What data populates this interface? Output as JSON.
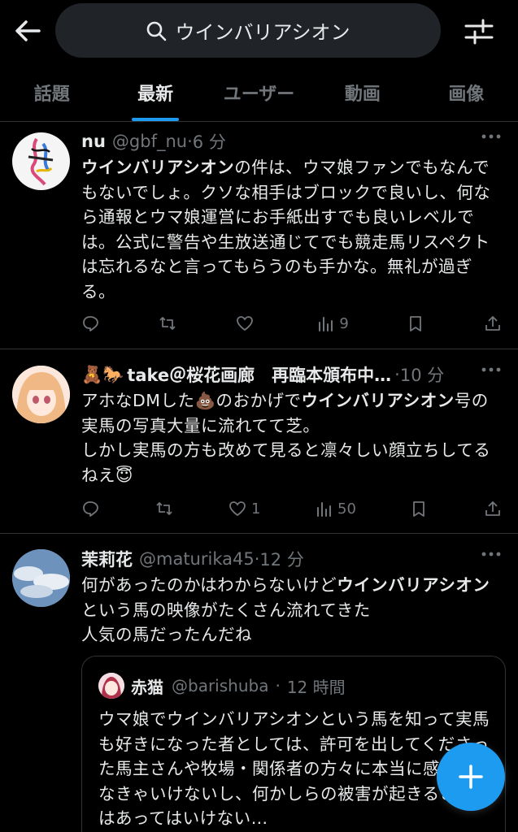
{
  "colors": {
    "accent": "#1d9bf0",
    "background": "#000000",
    "muted": "#71767b",
    "text": "#e7e9ea"
  },
  "search": {
    "query": "ウインバリアシオン"
  },
  "tabs": [
    {
      "label": "話題",
      "active": false
    },
    {
      "label": "最新",
      "active": true
    },
    {
      "label": "ユーザー",
      "active": false
    },
    {
      "label": "動画",
      "active": false
    },
    {
      "label": "画像",
      "active": false
    }
  ],
  "tweets": [
    {
      "name": "nu",
      "handle": "@gbf_nu",
      "sep": "·",
      "time": "6 分",
      "text_bold": "ウインバリアシオン",
      "text_rest": "の件は、ウマ娘ファンでもなんでもないでしょ。クソな相手はブロックで良いし、何なら通報とウマ娘運営にお手紙出すでも良いレベルでは。公式に警告や生放送通じてでも競走馬リスペクトは忘れるなと言ってもらうのも手かな。無礼が過ぎる。",
      "likes": "",
      "views": "9"
    },
    {
      "name_emoji": "🧸🐎",
      "name": "take＠桜花画廊　再臨本頒布中…",
      "sep": "·",
      "time": "10 分",
      "text_a": "アホなDMした",
      "text_emoji1": "💩",
      "text_b": "のおかげで",
      "text_bold": "ウインバリアシオン",
      "text_c": "号の実馬の写真大量に流れてて芝。",
      "text_d": "しかし実馬の方も改めて見ると凛々しい顔立ちしてるねえ",
      "text_emoji2": "😇",
      "likes": "1",
      "views": "50"
    },
    {
      "name": "茉莉花",
      "handle": "@maturika45",
      "sep": "·",
      "time": "12 分",
      "text_a": "何があったのかはわからないけど",
      "text_bold": "ウインバリアシオン",
      "text_b": "という馬の映像がたくさん流れてきた",
      "text_c": "人気の馬だったんだね",
      "quote": {
        "name": "赤猫",
        "handle": "@barishuba",
        "sep": "·",
        "time": "12 時間",
        "text": "ウマ娘でウインバリアシオンという馬を知って実馬も好きになった者としては、許可を出してくださった馬主さんや牧場・関係者の方々に本当に感謝しなきゃいけないし、何かしらの被害が起きることはあってはいけない…"
      }
    }
  ],
  "icons": [
    "back-arrow-icon",
    "search-icon",
    "filter-sliders-icon",
    "more-icon",
    "reply-icon",
    "retweet-icon",
    "like-icon",
    "views-icon",
    "bookmark-icon",
    "share-icon",
    "plus-icon"
  ]
}
